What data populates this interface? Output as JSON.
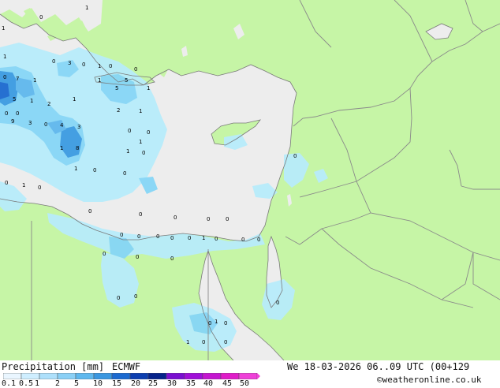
{
  "footer": {
    "title": "Precipitation [mm]",
    "model": "ECMWF",
    "valid_time": "We 18-03-2026 06..09 UTC (00+129",
    "credit": "©weatheronline.co.uk"
  },
  "legend": {
    "ticks": [
      "0.1",
      "0.5",
      "1",
      "2",
      "5",
      "10",
      "15",
      "20",
      "25",
      "30",
      "35",
      "40",
      "45",
      "50"
    ],
    "colors": [
      "#eaf6ff",
      "#cfeeff",
      "#aee0fb",
      "#8bd0f6",
      "#5fb8ee",
      "#3a97e0",
      "#1c6ad0",
      "#0d3fb0",
      "#06238a",
      "#7a0fd0",
      "#a00fd8",
      "#c416d0",
      "#df1cc8",
      "#ef40d8"
    ]
  },
  "colors": {
    "land": "#c6f5a6",
    "sea": "#ededed",
    "precip_light": "#b8ecfb",
    "precip_mid": "#86d6f7",
    "precip_heavy": "#3c9be2",
    "border": "#8a8a8a"
  },
  "map_labels": [
    "1",
    "0",
    "1",
    "0",
    "3",
    "1",
    "7",
    "1",
    "0",
    "1",
    "5",
    "1",
    "2",
    "1",
    "0",
    "5",
    "5",
    "1",
    "1",
    "0",
    "0",
    "2",
    "1",
    "9",
    "3",
    "0",
    "4",
    "3",
    "0",
    "0",
    "1",
    "8",
    "1",
    "0",
    "0",
    "1",
    "0",
    "0",
    "1",
    "0",
    "0",
    "1",
    "0",
    "0",
    "0",
    "0",
    "0",
    "0",
    "0",
    "0",
    "0",
    "0",
    "0",
    "1",
    "0",
    "0",
    "0",
    "0",
    "0",
    "0",
    "0",
    "0",
    "0",
    "0",
    "1",
    "0",
    "1",
    "0",
    "0",
    "0"
  ]
}
